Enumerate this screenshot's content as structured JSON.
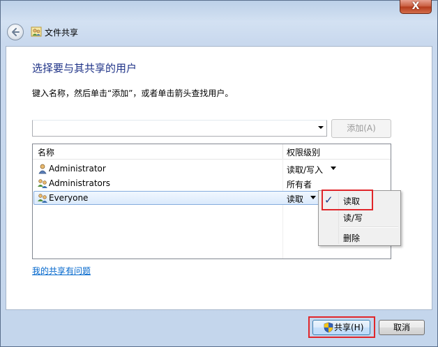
{
  "window": {
    "title": "文件共享",
    "close_label": "X"
  },
  "main": {
    "heading": "选择要与其共享的用户",
    "instruction": "键入名称，然后单击“添加”，或者单击箭头查找用户。",
    "combo_value": "",
    "add_button": "添加(A)",
    "columns": {
      "name": "名称",
      "permission": "权限级别"
    },
    "users": [
      {
        "name": "Administrator",
        "permission": "读取/写入",
        "has_dropdown": true
      },
      {
        "name": "Administrators",
        "permission": "所有者",
        "has_dropdown": false
      },
      {
        "name": "Everyone",
        "permission": "读取",
        "has_dropdown": true,
        "selected": true
      }
    ],
    "help_link": "我的共享有问题"
  },
  "permission_menu": {
    "items": [
      {
        "label": "读取",
        "checked": true
      },
      {
        "label": "读/写",
        "checked": false
      },
      {
        "label": "删除",
        "checked": false
      }
    ],
    "check_glyph": "✓"
  },
  "footer": {
    "share_button": "共享(H)",
    "cancel_button": "取消"
  },
  "colors": {
    "heading": "#1e3287",
    "link": "#0066cc",
    "highlight": "#e0262a"
  }
}
